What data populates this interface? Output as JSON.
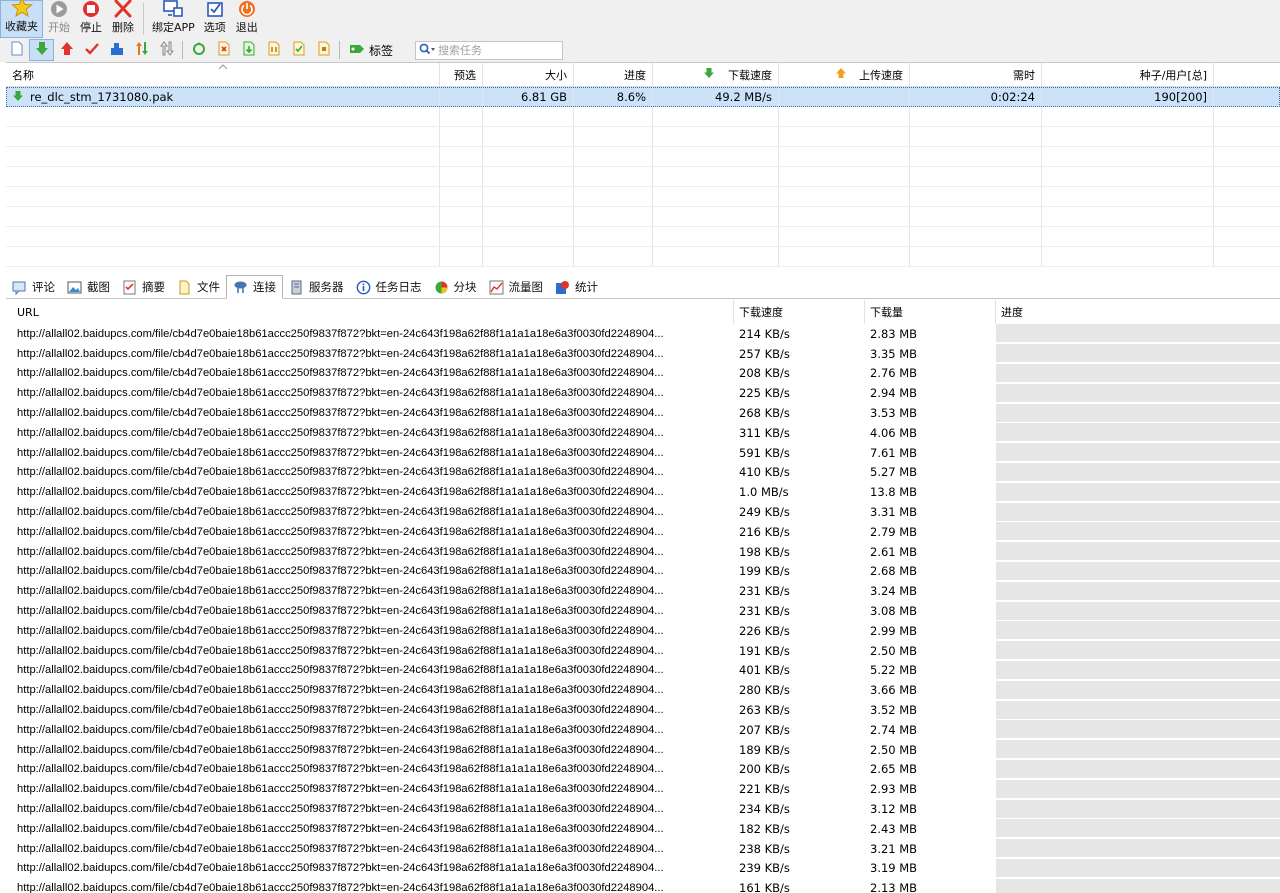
{
  "toolbar": {
    "buttons": [
      {
        "name": "favorites-button",
        "label": "收藏夹",
        "icon": "star-icon",
        "active": true,
        "disabled": false
      },
      {
        "name": "start-button",
        "label": "开始",
        "icon": "play-icon",
        "active": false,
        "disabled": true
      },
      {
        "name": "stop-button",
        "label": "停止",
        "icon": "stop-icon",
        "active": false,
        "disabled": false
      },
      {
        "name": "delete-button",
        "label": "删除",
        "icon": "close-icon",
        "active": false,
        "disabled": false
      },
      {
        "name": "bind-app-button",
        "label": "绑定APP",
        "icon": "monitor-icon",
        "active": false,
        "disabled": false
      },
      {
        "name": "options-button",
        "label": "选项",
        "icon": "options-icon",
        "active": false,
        "disabled": false
      },
      {
        "name": "exit-button",
        "label": "退出",
        "icon": "power-icon",
        "active": false,
        "disabled": false
      }
    ]
  },
  "small_toolbar": {
    "tag_label": "标签",
    "search_placeholder": "搜索任务"
  },
  "task_table": {
    "columns": [
      "名称",
      "预选",
      "大小",
      "进度",
      "下载速度",
      "上传速度",
      "需时",
      "种子/用户[总]"
    ],
    "rows": [
      {
        "name": "re_dlc_stm_1731080.pak",
        "preselect": "",
        "size": "6.81 GB",
        "progress": "8.6%",
        "down_speed": "49.2 MB/s",
        "up_speed": "",
        "eta": "0:02:24",
        "seeds": "190[200]"
      }
    ]
  },
  "detail_tabs": [
    {
      "name": "tab-comments",
      "label": "评论",
      "icon": "comment-icon",
      "active": false
    },
    {
      "name": "tab-screenshot",
      "label": "截图",
      "icon": "image-icon",
      "active": false
    },
    {
      "name": "tab-summary",
      "label": "摘要",
      "icon": "summary-icon",
      "active": false
    },
    {
      "name": "tab-files",
      "label": "文件",
      "icon": "file-icon",
      "active": false
    },
    {
      "name": "tab-connections",
      "label": "连接",
      "icon": "network-icon",
      "active": true
    },
    {
      "name": "tab-servers",
      "label": "服务器",
      "icon": "server-icon",
      "active": false
    },
    {
      "name": "tab-task-log",
      "label": "任务日志",
      "icon": "info-icon",
      "active": false
    },
    {
      "name": "tab-pieces",
      "label": "分块",
      "icon": "pieces-icon",
      "active": false
    },
    {
      "name": "tab-traffic",
      "label": "流量图",
      "icon": "chart-icon",
      "active": false
    },
    {
      "name": "tab-stats",
      "label": "统计",
      "icon": "stats-icon",
      "active": false
    }
  ],
  "connections": {
    "columns": [
      "URL",
      "下载速度",
      "下载量",
      "进度"
    ],
    "url": "http://allall02.baidupcs.com/file/cb4d7e0baie18b61accc250f9837f872?bkt=en-24c643f198a62f88f1a1a1a18e6a3f0030fd2248904...",
    "rows": [
      {
        "speed": "214 KB/s",
        "amount": "2.83 MB",
        "progress": 0
      },
      {
        "speed": "257 KB/s",
        "amount": "3.35 MB",
        "progress": 0
      },
      {
        "speed": "208 KB/s",
        "amount": "2.76 MB",
        "progress": 0
      },
      {
        "speed": "225 KB/s",
        "amount": "2.94 MB",
        "progress": 0
      },
      {
        "speed": "268 KB/s",
        "amount": "3.53 MB",
        "progress": 0
      },
      {
        "speed": "311 KB/s",
        "amount": "4.06 MB",
        "progress": 0
      },
      {
        "speed": "591 KB/s",
        "amount": "7.61 MB",
        "progress": 0
      },
      {
        "speed": "410 KB/s",
        "amount": "5.27 MB",
        "progress": 0
      },
      {
        "speed": "1.0 MB/s",
        "amount": "13.8 MB",
        "progress": 0
      },
      {
        "speed": "249 KB/s",
        "amount": "3.31 MB",
        "progress": 0
      },
      {
        "speed": "216 KB/s",
        "amount": "2.79 MB",
        "progress": 0
      },
      {
        "speed": "198 KB/s",
        "amount": "2.61 MB",
        "progress": 0
      },
      {
        "speed": "199 KB/s",
        "amount": "2.68 MB",
        "progress": 0
      },
      {
        "speed": "231 KB/s",
        "amount": "3.24 MB",
        "progress": 0
      },
      {
        "speed": "231 KB/s",
        "amount": "3.08 MB",
        "progress": 0
      },
      {
        "speed": "226 KB/s",
        "amount": "2.99 MB",
        "progress": 0
      },
      {
        "speed": "191 KB/s",
        "amount": "2.50 MB",
        "progress": 0
      },
      {
        "speed": "401 KB/s",
        "amount": "5.22 MB",
        "progress": 0
      },
      {
        "speed": "280 KB/s",
        "amount": "3.66 MB",
        "progress": 0
      },
      {
        "speed": "263 KB/s",
        "amount": "3.52 MB",
        "progress": 0
      },
      {
        "speed": "207 KB/s",
        "amount": "2.74 MB",
        "progress": 0
      },
      {
        "speed": "189 KB/s",
        "amount": "2.50 MB",
        "progress": 0
      },
      {
        "speed": "200 KB/s",
        "amount": "2.65 MB",
        "progress": 0
      },
      {
        "speed": "221 KB/s",
        "amount": "2.93 MB",
        "progress": 0
      },
      {
        "speed": "234 KB/s",
        "amount": "3.12 MB",
        "progress": 0
      },
      {
        "speed": "182 KB/s",
        "amount": "2.43 MB",
        "progress": 0
      },
      {
        "speed": "238 KB/s",
        "amount": "3.21 MB",
        "progress": 0
      },
      {
        "speed": "239 KB/s",
        "amount": "3.19 MB",
        "progress": 0
      },
      {
        "speed": "161 KB/s",
        "amount": "2.13 MB",
        "progress": 0
      }
    ]
  },
  "colors": {
    "selection": "#cce2f8",
    "progress_track": "#e6e6e6",
    "download_arrow": "#3aa83a",
    "upload_arrow": "#f0a020"
  }
}
